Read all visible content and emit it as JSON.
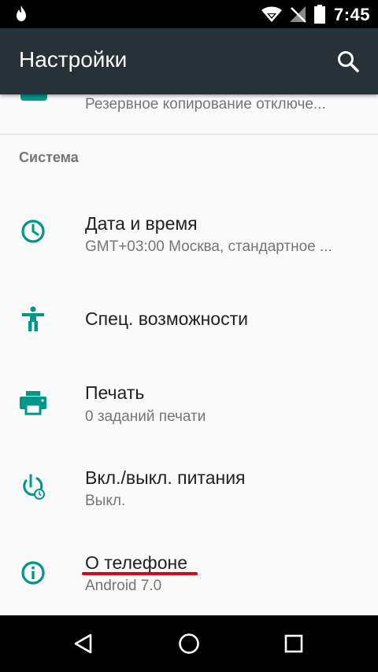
{
  "status_bar": {
    "time": "7:45",
    "icons": [
      "flame-notification-icon",
      "wifi-icon",
      "no-signal-icon",
      "battery-icon"
    ]
  },
  "toolbar": {
    "title": "Настройки",
    "search_icon": "search-icon"
  },
  "partial_item": {
    "summary": "Резервное копирование отключе..."
  },
  "section": {
    "header": "Система"
  },
  "items": [
    {
      "icon": "clock-icon",
      "title": "Дата и время",
      "summary": "GMT+03:00 Москва, стандартное ..."
    },
    {
      "icon": "accessibility-icon",
      "title": "Спец. возможности",
      "summary": ""
    },
    {
      "icon": "print-icon",
      "title": "Печать",
      "summary": "0 заданий печати"
    },
    {
      "icon": "power-schedule-icon",
      "title": "Вкл./выкл. питания",
      "summary": "Выкл."
    },
    {
      "icon": "info-icon",
      "title": "О телефоне",
      "summary": "Android 7.0"
    }
  ],
  "nav_bar": {
    "buttons": [
      "back-icon",
      "home-icon",
      "recents-icon"
    ]
  },
  "colors": {
    "accent": "#009688",
    "toolbar": "#263238",
    "highlight_underline": "#e0001b"
  }
}
